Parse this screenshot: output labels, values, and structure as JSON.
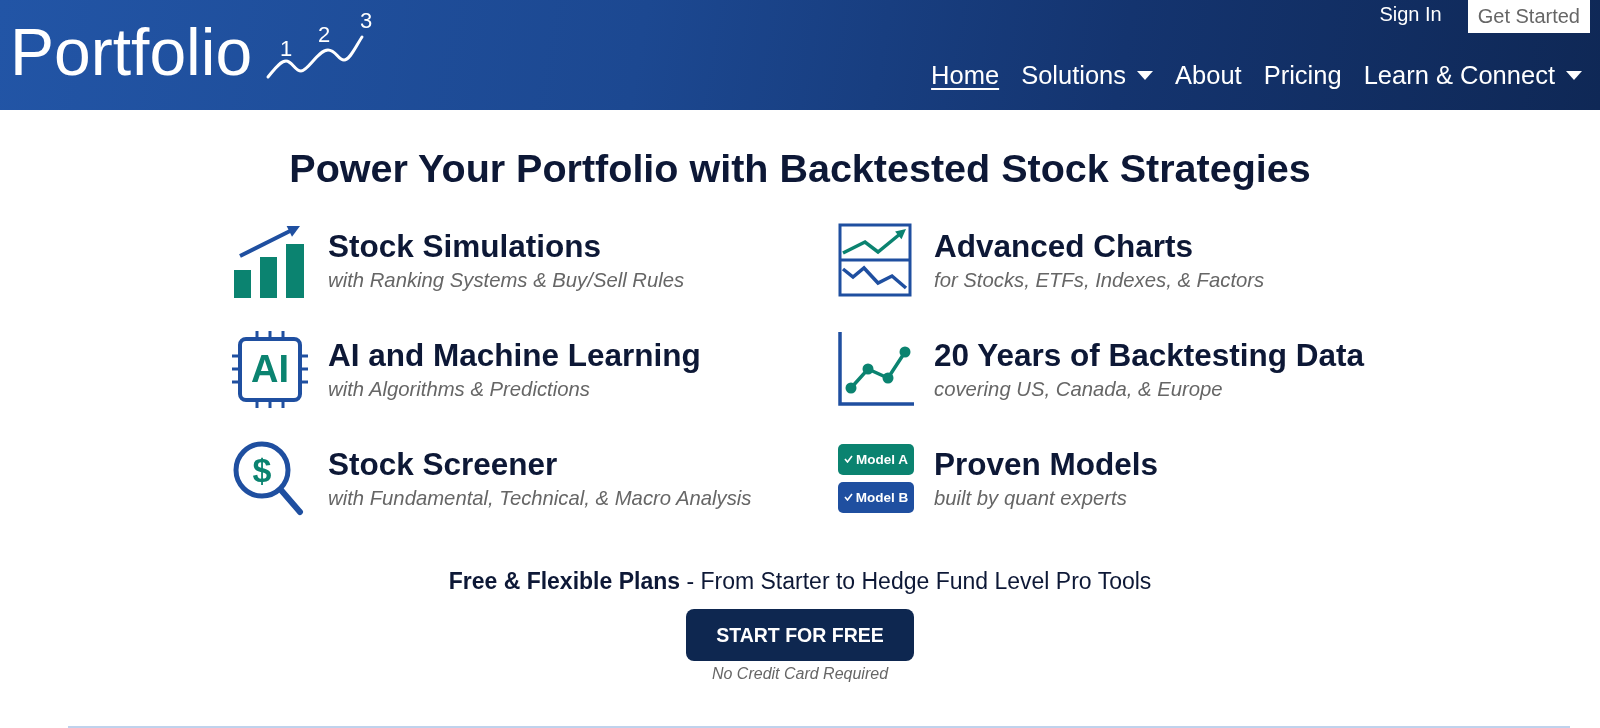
{
  "header": {
    "logo": {
      "wordmark": "Portfolio",
      "digits": [
        "1",
        "2",
        "3"
      ]
    },
    "top_links": [
      {
        "label": "Sign In",
        "kind": "link"
      },
      {
        "label": "Get Started",
        "kind": "button"
      }
    ],
    "nav": [
      {
        "label": "Home",
        "selected": true,
        "dropdown": false
      },
      {
        "label": "Solutions",
        "selected": false,
        "dropdown": true
      },
      {
        "label": "About",
        "selected": false,
        "dropdown": false
      },
      {
        "label": "Pricing",
        "selected": false,
        "dropdown": false
      },
      {
        "label": "Learn & Connect",
        "selected": false,
        "dropdown": true
      }
    ]
  },
  "hero": {
    "title": "Power Your Portfolio with Backtested Stock Strategies",
    "features": [
      {
        "kind": "simulations",
        "title": "Stock Simulations",
        "subtitle": "with Ranking Systems & Buy/Sell Rules"
      },
      {
        "kind": "charts",
        "title": "Advanced Charts",
        "subtitle": "for Stocks, ETFs, Indexes, & Factors"
      },
      {
        "kind": "ai",
        "icon_text": "AI",
        "title": "AI and Machine Learning",
        "subtitle": "with Algorithms & Predictions"
      },
      {
        "kind": "backtesting",
        "title": "20 Years of Backtesting Data",
        "subtitle": "covering US, Canada, & Europe"
      },
      {
        "kind": "screener",
        "icon_text": "$",
        "title": "Stock Screener",
        "subtitle": "with Fundamental, Technical, & Macro Analysis"
      },
      {
        "kind": "models",
        "badges": [
          {
            "label": "Model A",
            "color": "#0b8370"
          },
          {
            "label": "Model B",
            "color": "#1f4fa0"
          }
        ],
        "title": "Proven Models",
        "subtitle": "built by quant experts"
      }
    ],
    "plans_line": "**Free & Flexible Plans** - From Starter to Hedge Fund Level Pro Tools",
    "cta": {
      "label": "START FOR FREE"
    },
    "cta_note": "No Credit Card Required"
  }
}
